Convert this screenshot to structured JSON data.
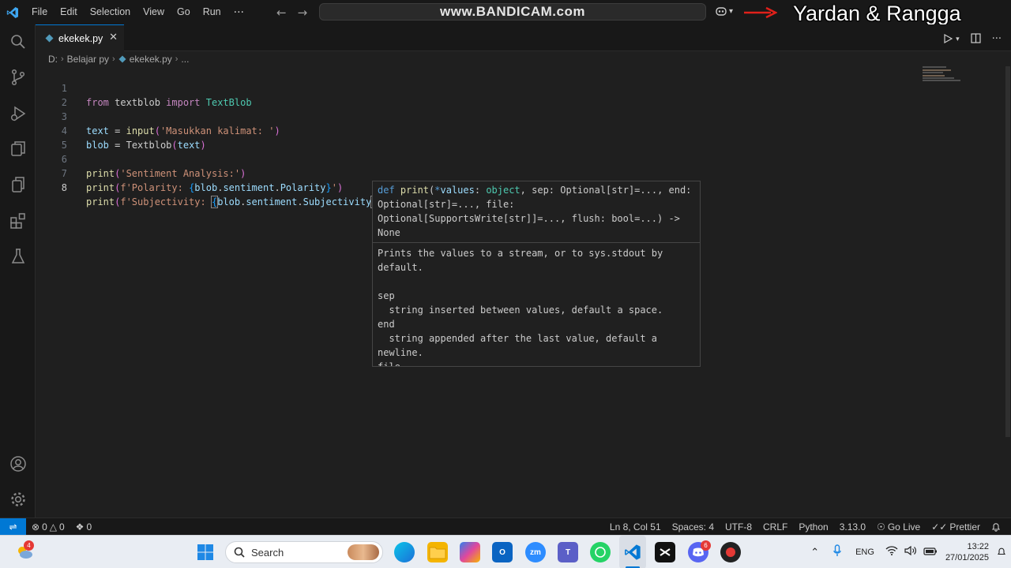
{
  "titlebar": {
    "menu": [
      "File",
      "Edit",
      "Selection",
      "View",
      "Go",
      "Run"
    ],
    "more": "···",
    "watermark": "www.BANDICAM.com",
    "overlay_text": "Yardan & Rangga"
  },
  "tab": {
    "filename": "ekekek.py",
    "close": "✕"
  },
  "breadcrumb": {
    "drive": "D:",
    "folder": "Belajar py",
    "file": "ekekek.py",
    "more": "..."
  },
  "editor": {
    "line_numbers": [
      "1",
      "2",
      "3",
      "4",
      "5",
      "6",
      "7",
      "8"
    ],
    "active_line": 8
  },
  "hover": {
    "signature": {
      "def": "def ",
      "name": "print",
      "open": "(",
      "star": "*",
      "param1": "values",
      "colon1": ": ",
      "type1": "object",
      "rest": ", sep: Optional[str]=..., end: Optional[str]=..., file: Optional[SupportsWrite[str]]=..., flush: bool=...) -> None"
    },
    "doc": "Prints the values to a stream, or to sys.stdout by default.\n\nsep\n  string inserted between values, default a space.\nend\n  string appended after the last value, default a newline.\nfile"
  },
  "statusbar": {
    "errors": "0",
    "warnings": "0",
    "ports": "0",
    "position": "Ln 8, Col 51",
    "spaces": "Spaces: 4",
    "encoding": "UTF-8",
    "eol": "CRLF",
    "language": "Python",
    "version": "3.13.0",
    "golive": "Go Live",
    "prettier": "Prettier"
  },
  "taskbar": {
    "search_placeholder": "Search",
    "weather_badge": "4",
    "discord_badge": "6",
    "lang": "ENG",
    "time": "13:22",
    "date": "27/01/2025"
  },
  "colors": {
    "accent": "#0078d4",
    "editor_bg": "#1f1f1f",
    "chrome_bg": "#181818"
  }
}
